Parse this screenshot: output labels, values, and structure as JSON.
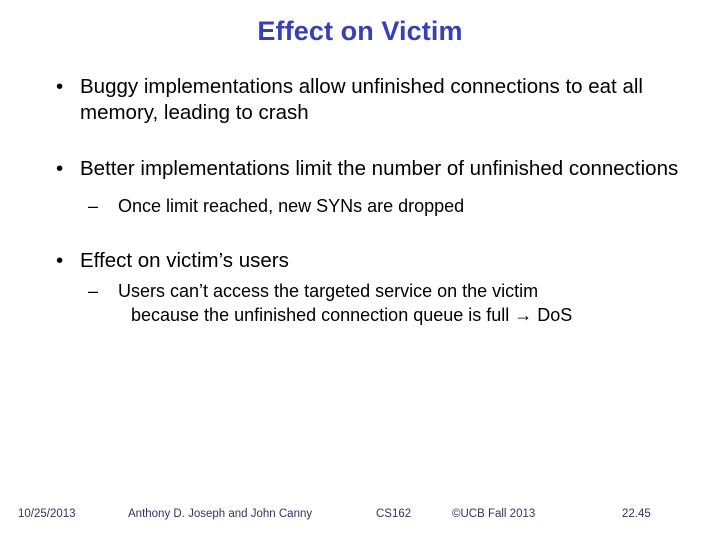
{
  "slide": {
    "title": "Effect on Victim",
    "title_color": "#3741b5",
    "background_color": "#ffffff",
    "body_color": "#000000"
  },
  "content": {
    "bullet_marker": "•",
    "sub_bullet_marker": "–",
    "blocks": [
      {
        "level": 1,
        "text": "Buggy implementations allow unfinished connections to eat all memory, leading to crash"
      },
      {
        "level": 1,
        "text": "Better implementations limit the number of unfinished connections"
      },
      {
        "level": 2,
        "text": "Once limit reached, new SYNs are dropped"
      },
      {
        "level": 1,
        "text": "Effect on victim’s users"
      },
      {
        "level": 2,
        "line1": "Users can’t access the targeted service on the victim",
        "line2": "because the unfinished connection queue is full → DoS"
      }
    ]
  },
  "footer": {
    "date": "10/25/2013",
    "authors": "Anthony D. Joseph and John Canny",
    "course": "CS162",
    "copyright": "©UCB Fall 2013",
    "page": "22.45",
    "color": "#333366"
  }
}
